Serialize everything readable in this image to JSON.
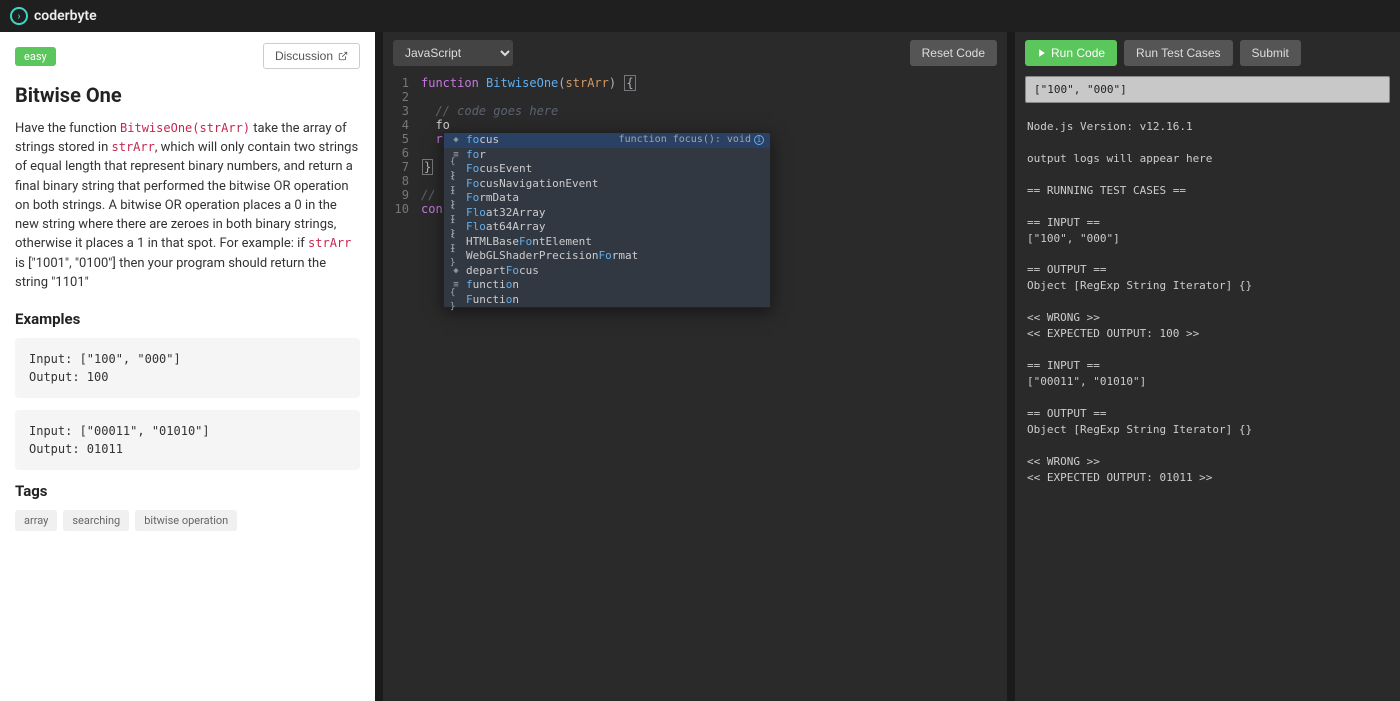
{
  "header": {
    "brand": "coderbyte"
  },
  "problem": {
    "difficulty": "easy",
    "discussion_label": "Discussion",
    "title": "Bitwise One",
    "desc_prefix": "Have the function ",
    "func_sig": "BitwiseOne(strArr)",
    "desc_mid1": " take the array of strings stored in ",
    "param1": "strArr",
    "desc_mid2": ", which will only contain two strings of equal length that represent binary numbers, and return a final binary string that performed the bitwise OR operation on both strings. A bitwise OR operation places a 0 in the new string where there are zeroes in both binary strings, otherwise it places a 1 in that spot. For example: if ",
    "param2": "strArr",
    "desc_end": " is [\"1001\", \"0100\"] then your program should return the string \"1101\"",
    "examples_heading": "Examples",
    "example1_input": "Input: [\"100\", \"000\"]",
    "example1_output": "Output: 100",
    "example2_input": "Input: [\"00011\", \"01010\"]",
    "example2_output": "Output: 01011",
    "tags_heading": "Tags",
    "tags": [
      "array",
      "searching",
      "bitwise operation"
    ]
  },
  "editor": {
    "language": "JavaScript",
    "reset_label": "Reset Code",
    "line_count": 10,
    "autocomplete_hint": "function focus(): void",
    "ac_items": [
      {
        "label_pre": "",
        "hl": "fo",
        "label_post": "cus",
        "kind": "cube",
        "selected": true
      },
      {
        "label_pre": "",
        "hl": "fo",
        "label_post": "r",
        "kind": "lines"
      },
      {
        "label_pre": "",
        "hl": "Fo",
        "label_post": "cusEvent",
        "kind": "braces"
      },
      {
        "label_pre": "",
        "hl": "Fo",
        "label_post": "cusNavigationEvent",
        "kind": "braces"
      },
      {
        "label_pre": "",
        "hl": "Fo",
        "label_post": "rmData",
        "kind": "braces"
      },
      {
        "label_pre": "",
        "hl": "Flo",
        "label_post": "at32Array",
        "kind": "braces"
      },
      {
        "label_pre": "",
        "hl": "Flo",
        "label_post": "at64Array",
        "kind": "braces"
      },
      {
        "label_pre": "HTMLBase",
        "hl": "Fo",
        "label_post": "ntElement",
        "kind": "braces"
      },
      {
        "label_pre": "WebGLShaderPrecision",
        "hl": "Fo",
        "label_post": "rmat",
        "kind": "braces"
      },
      {
        "label_pre": "depart",
        "hl": "Fo",
        "label_post": "cus",
        "kind": "cube"
      },
      {
        "label_pre": "",
        "hl2a": "f",
        "mid": "uncti",
        "hl2b": "o",
        "label_post": "n",
        "kind": "lines",
        "split": true
      },
      {
        "label_pre": "",
        "hl2a": "F",
        "mid": "uncti",
        "hl2b": "o",
        "label_post": "n",
        "kind": "braces",
        "split": true
      }
    ],
    "code": {
      "l1a": "function",
      "l1b": " ",
      "l1c": "BitwiseOne",
      "l1d": "(",
      "l1e": "strArr",
      "l1f": ") ",
      "l1g": "{",
      "l3": "  // code goes here",
      "l4": "  fo",
      "l5a": "  re",
      "l5b": "",
      "l7": "}",
      "l9": "// k",
      "l10": "cons"
    }
  },
  "runner": {
    "run_label": "Run Code",
    "test_label": "Run Test Cases",
    "submit_label": "Submit",
    "input_value": "[\"100\", \"000\"]",
    "output": "Node.js Version: v12.16.1\n\noutput logs will appear here\n\n== RUNNING TEST CASES ==\n\n== INPUT ==\n[\"100\", \"000\"]\n\n== OUTPUT ==\nObject [RegExp String Iterator] {}\n\n<< WRONG >>\n<< EXPECTED OUTPUT: 100 >>\n\n== INPUT ==\n[\"00011\", \"01010\"]\n\n== OUTPUT ==\nObject [RegExp String Iterator] {}\n\n<< WRONG >>\n<< EXPECTED OUTPUT: 01011 >>"
  }
}
